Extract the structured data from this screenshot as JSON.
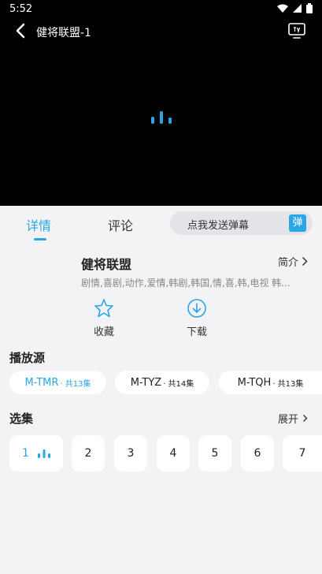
{
  "status": {
    "time": "5:52"
  },
  "player": {
    "title": "健将联盟-1"
  },
  "tabs": [
    {
      "label": "详情"
    },
    {
      "label": "评论"
    }
  ],
  "danmaku": {
    "placeholder": "点我发送弹幕",
    "button": "弹"
  },
  "detail": {
    "title": "健将联盟",
    "intro": "简介",
    "tags": "剧情,喜剧,动作,爱情,韩剧,韩国,情,喜,韩,电视 韩..."
  },
  "actions": {
    "favorite": "收藏",
    "download": "下载"
  },
  "sources": {
    "heading": "播放源",
    "items": [
      {
        "name": "M-TMR",
        "count": "· 共13集"
      },
      {
        "name": "M-TYZ",
        "count": "· 共14集"
      },
      {
        "name": "M-TQH",
        "count": "· 共13集"
      }
    ]
  },
  "episodes": {
    "heading": "选集",
    "expand": "展开",
    "items": [
      "1",
      "2",
      "3",
      "4",
      "5",
      "6",
      "7"
    ]
  },
  "colors": {
    "accent": "#29a6e5",
    "player_bg": "#000000",
    "page_bg": "#f3f3f5"
  }
}
